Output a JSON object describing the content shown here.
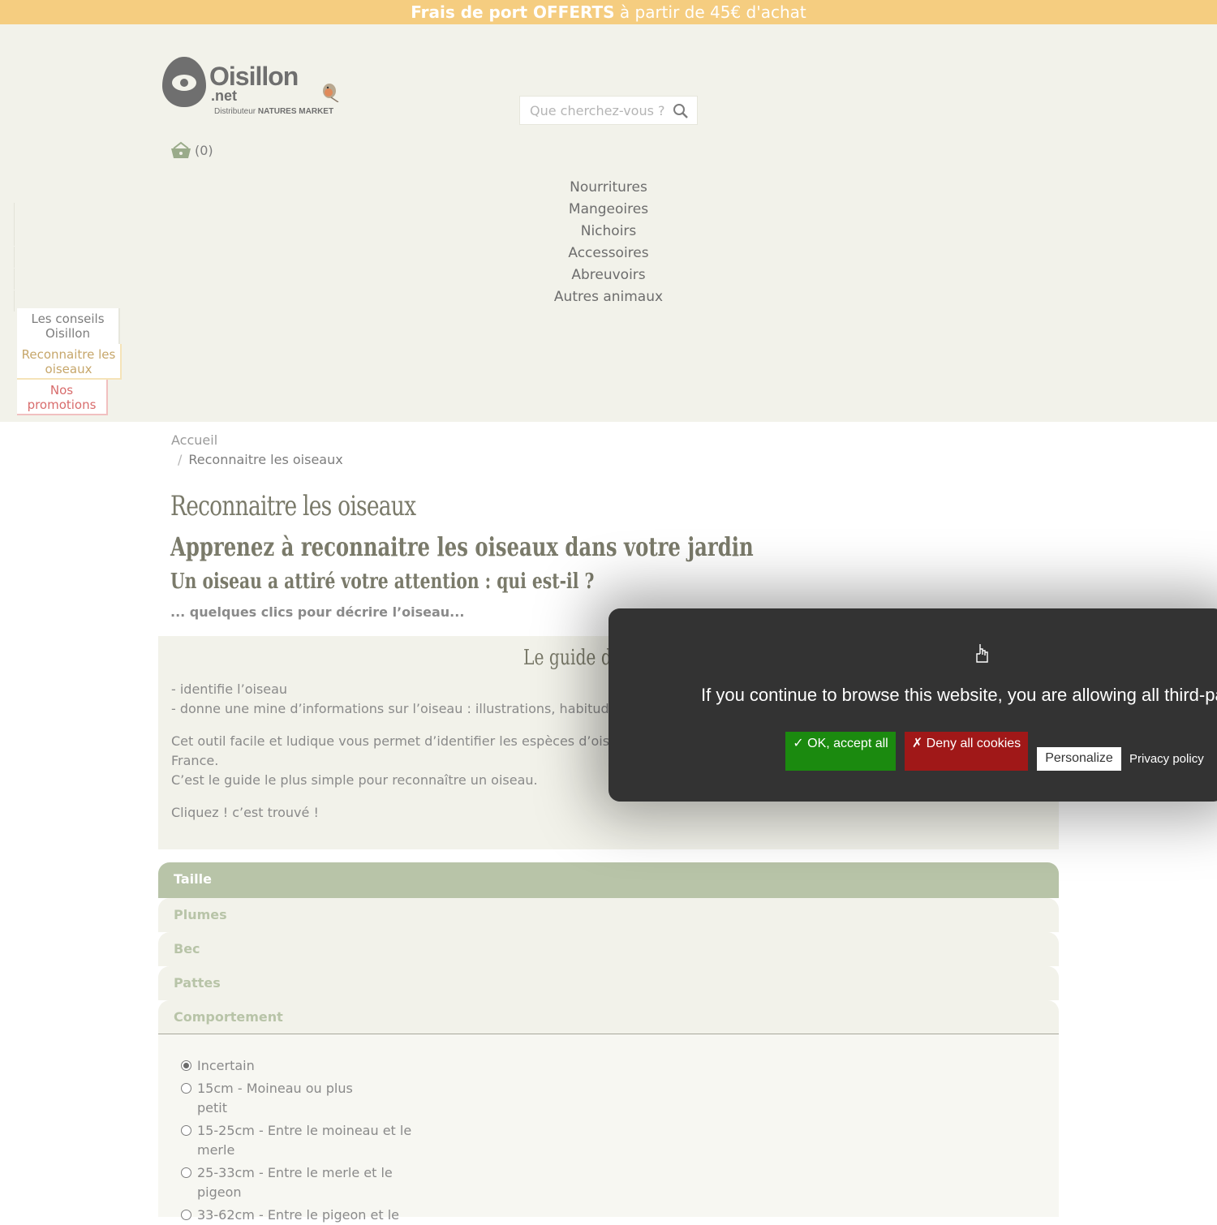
{
  "topbar": {
    "prefix": "Frais de port OFFERTS",
    "suffix": " à partir de 45€ d'achat"
  },
  "logo": {
    "name": "Oisillon",
    "tld": ".net",
    "tagline_prefix": "Distributeur",
    "tagline_brand": "NATURES MARKET"
  },
  "search": {
    "placeholder": "Que cherchez-vous ?"
  },
  "cart": {
    "count": "(0)"
  },
  "menu": [
    "Nourritures",
    "Mangeoires",
    "Nichoirs",
    "Accessoires",
    "Abreuvoirs",
    "Autres animaux"
  ],
  "side_tabs": {
    "conseils": "Les conseils Oisillon",
    "reconnaitre": "Reconnaitre les oiseaux",
    "promos": "Nos promotions"
  },
  "breadcrumb": {
    "home": "Accueil",
    "current": "Reconnaitre les oiseaux"
  },
  "page": {
    "title": "Reconnaitre les oiseaux",
    "subtitle": "Apprenez à reconnaitre les oiseaux dans votre jardin",
    "question": "Un oiseau a attiré votre attention : qui est-il ?",
    "lead": "... quelques clics pour décrire l’oiseau..."
  },
  "guide": {
    "title": "Le guide de",
    "line1": "- identifie l’oiseau",
    "line2": "- donne une mine d’informations sur l’oiseau : illustrations, habitudes",
    "line3": "Cet outil facile et ludique vous permet d’identifier les espèces d’oisea",
    "line4": "France.",
    "line5": "C’est le guide le plus simple pour reconnaître un oiseau.",
    "line6": "Cliquez ! c’est trouvé !"
  },
  "accordion": [
    "Taille",
    "Plumes",
    "Bec",
    "Pattes",
    "Comportement"
  ],
  "size_options": [
    "Incertain",
    "15cm - Moineau ou plus petit",
    "15-25cm - Entre le moineau et le merle",
    "25-33cm - Entre le merle et le pigeon",
    "33-62cm - Entre le pigeon et le"
  ],
  "cookie": {
    "message": "If you continue to browse this website, you are allowing all third-party",
    "accept": "✓ OK, accept all",
    "deny": "✗ Deny all cookies",
    "personalize": "Personalize",
    "privacy": "Privacy policy"
  },
  "colors": {
    "topbar": "#f5cd80",
    "header_bg": "#f2f2ea",
    "accent_green": "#b8c4a8",
    "accept": "#1b8a0f",
    "deny": "#a01818"
  }
}
